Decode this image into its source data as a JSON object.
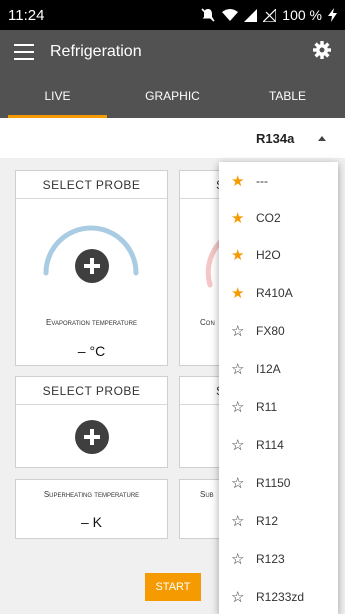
{
  "status": {
    "time": "11:24",
    "battery": "100 %"
  },
  "appbar": {
    "title": "Refrigeration"
  },
  "tabs": [
    {
      "label": "LIVE",
      "active": true
    },
    {
      "label": "GRAPHIC",
      "active": false
    },
    {
      "label": "TABLE",
      "active": false
    }
  ],
  "refrigerant": {
    "selected": "R134a"
  },
  "cards": {
    "evap": {
      "header": "SELECT PROBE",
      "label": "Evaporation temperature",
      "reading": "– °C"
    },
    "cond": {
      "header": "S",
      "label": "Con"
    },
    "superheat_probe": {
      "header": "SELECT PROBE"
    },
    "superheat_probe_right": {
      "header": "S"
    },
    "superheat": {
      "label": "Superheating temperature",
      "reading": "– K"
    },
    "subcool": {
      "label": "Sub"
    }
  },
  "start_label": "START",
  "dropdown": {
    "options": [
      {
        "label": "---",
        "favorite": true
      },
      {
        "label": "CO2",
        "favorite": true
      },
      {
        "label": "H2O",
        "favorite": true
      },
      {
        "label": "R410A",
        "favorite": true
      },
      {
        "label": "FX80",
        "favorite": false
      },
      {
        "label": "I12A",
        "favorite": false
      },
      {
        "label": "R11",
        "favorite": false
      },
      {
        "label": "R114",
        "favorite": false
      },
      {
        "label": "R1150",
        "favorite": false
      },
      {
        "label": "R12",
        "favorite": false
      },
      {
        "label": "R123",
        "favorite": false
      },
      {
        "label": "R1233zd",
        "favorite": false
      }
    ]
  },
  "colors": {
    "accent": "#f59a00",
    "appbar": "#525252",
    "evap_gauge": "#a9cce3",
    "cond_gauge": "#f4c6c6"
  }
}
